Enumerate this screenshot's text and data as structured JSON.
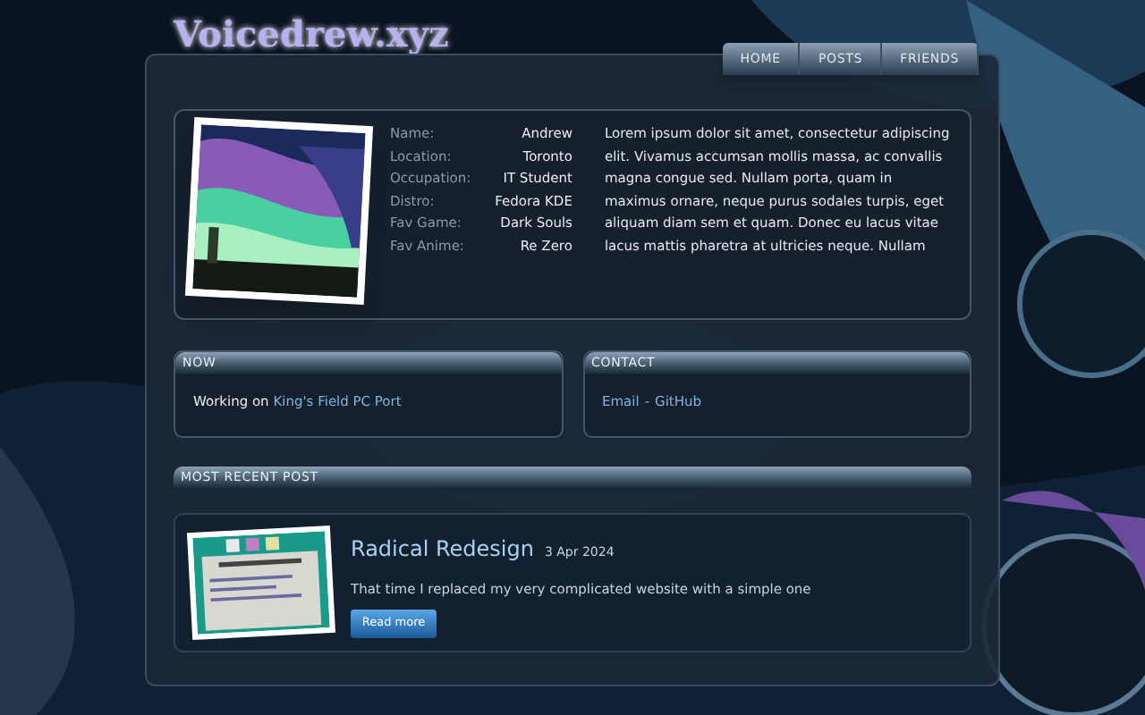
{
  "logo": {
    "title": "Voicedrew.xyz"
  },
  "nav": [
    {
      "label": "HOME"
    },
    {
      "label": "POSTS"
    },
    {
      "label": "FRIENDS"
    }
  ],
  "profile": {
    "fields": [
      {
        "label": "Name:",
        "value": "Andrew"
      },
      {
        "label": "Location:",
        "value": "Toronto"
      },
      {
        "label": "Occupation:",
        "value": "IT Student"
      },
      {
        "label": "Distro:",
        "value": "Fedora KDE"
      },
      {
        "label": "Fav Game:",
        "value": "Dark Souls"
      },
      {
        "label": "Fav Anime:",
        "value": "Re Zero"
      }
    ],
    "bio": "Lorem ipsum dolor sit amet, consectetur adipiscing elit. Vivamus accumsan mollis massa, ac convallis magna congue sed. Nullam porta, quam in maximus ornare, neque purus sodales turpis, eget aliquam diam sem et quam. Donec eu lacus vitae lacus mattis pharetra at ultricies neque. Nullam"
  },
  "now": {
    "heading": "NOW",
    "prefix": "Working on",
    "link": "King's Field PC Port"
  },
  "contact": {
    "heading": "CONTACT",
    "links": [
      {
        "label": "Email"
      },
      {
        "label": "GitHub"
      }
    ],
    "separator": "-"
  },
  "recent_post": {
    "heading": "MOST RECENT POST",
    "title": "Radical Redesign",
    "date": "3 Apr 2024",
    "summary": "That time I replaced my very complicated website with a simple one",
    "button": "Read more"
  }
}
